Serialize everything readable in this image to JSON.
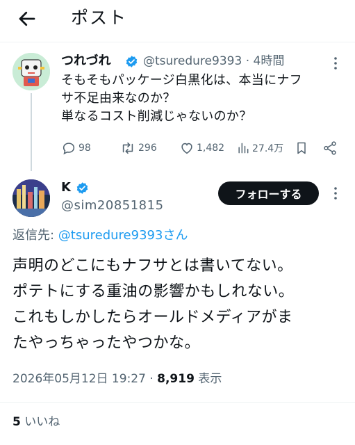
{
  "header": {
    "title": "ポスト"
  },
  "original_post": {
    "display_name": "つれづれ",
    "handle": "@tsuredure9393",
    "separator": "·",
    "time": "4時間",
    "lines": [
      "そもそもパッケージ白黒化は、本当にナフ",
      "サ不足由来なのか？",
      "単なるコスト削減じゃないのか？"
    ],
    "replies": "98",
    "reposts": "296",
    "likes": "1,482",
    "views": "27.4万"
  },
  "reply_post": {
    "display_name": "K",
    "handle": "@sim20851815",
    "follow_label": "フォローする",
    "reply_to_prefix": "返信先: ",
    "reply_to_handle": "@tsuredure9393さん",
    "lines": [
      "声明のどこにもナフサとは書いてない。",
      "ポテトにする重油の影響かもしれない。",
      "これもしかしたらオールドメディアがま",
      "たやっちゃったやつかな。"
    ],
    "timestamp": "2026年05月12日 19:27 · ",
    "view_count": "8,919",
    "view_label": " 表示",
    "like_count": "5",
    "like_label": " いいね"
  },
  "colors": {
    "text": "#0f1419",
    "secondary": "#536471",
    "link": "#1d9bf0",
    "verified": "#1d9bf0",
    "divider": "#eff3f4"
  },
  "icons": [
    "back-arrow-icon",
    "verified-badge-icon",
    "more-options-icon",
    "reply-icon",
    "repost-icon",
    "like-icon",
    "views-icon",
    "bookmark-icon",
    "share-icon"
  ]
}
